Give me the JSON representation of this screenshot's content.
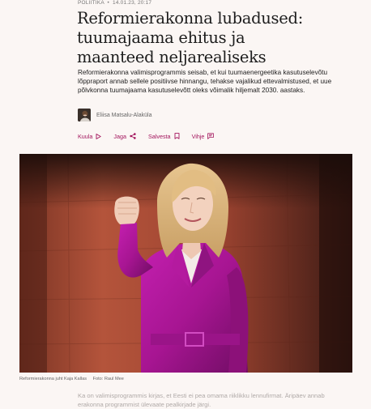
{
  "article": {
    "category": "Poliitika",
    "separator": "•",
    "date": "14.01.23, 20:17",
    "title": "Reformierakonna lubadused: tuumajaama ehitus ja maanteed neljarealiseks",
    "lead": "Reformierakonna valimisprogrammis seisab, et kui tuumaenergeetika kasutuselevõtu lõppraport annab sellele positiivse hinnangu, tehakse vajalikud ettevalmistused, et uue põlvkonna tuumajaama kasutuselevõtt oleks võimalik hiljemalt 2030. aastaks.",
    "author": "Eliisa Matsalu-Alaküla",
    "caption": "Reformierakonna juht Kaja Kallas",
    "photo_credit": "Foto: Raul Mee",
    "body_preview": "Ka on valimisprogrammis kirjas, et Eesti ei pea omama riiklikku lennufirmat. Äripäev annab erakonna programmist ülevaate pealkirjade järgi."
  },
  "actions": [
    {
      "label": "Kuula",
      "icon": "play-icon"
    },
    {
      "label": "Jaga",
      "icon": "share-icon"
    },
    {
      "label": "Salvesta",
      "icon": "bookmark-icon"
    },
    {
      "label": "Vihje",
      "icon": "comment-icon"
    }
  ],
  "colors": {
    "accent": "#a3155d",
    "background": "#fbf6f4",
    "text": "#1d1d1d",
    "muted": "#777777"
  }
}
